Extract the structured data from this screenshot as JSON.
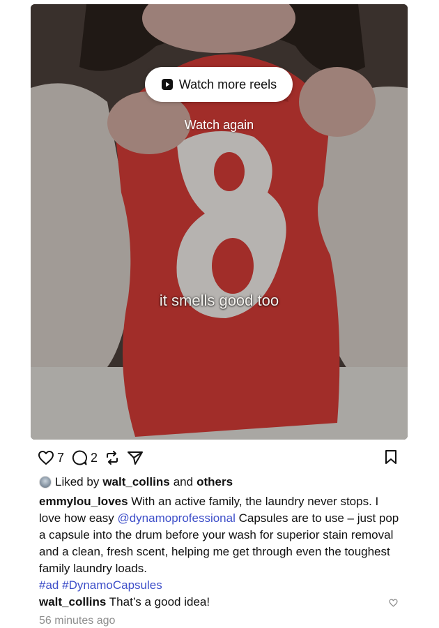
{
  "media": {
    "reels_button_label": "Watch more reels",
    "watch_again_label": "Watch again",
    "caption_overlay": "it smells good too",
    "jersey_number": "8"
  },
  "actions": {
    "likes_count": "7",
    "comments_count": "2"
  },
  "likes": {
    "prefix": "Liked by",
    "user": "walt_collins",
    "and": "and",
    "others": "others"
  },
  "post": {
    "author": "emmylou_loves",
    "text_1": "With an active family, the laundry never stops. I love how easy",
    "mention": "@dynamoprofessional",
    "text_2": "Capsules are to use – just pop a capsule into the drum before your wash for superior stain removal and a clean, fresh scent, helping me get through even the toughest family laundry loads.",
    "hashtag_1": "#ad",
    "hashtag_2": "#DynamoCapsules"
  },
  "comment": {
    "user": "walt_collins",
    "text": "That’s a good idea!"
  },
  "timestamp": "56 minutes ago",
  "colors": {
    "link": "#3e4fc9",
    "jersey": "#cf3a35",
    "muted": "#8e8e8e"
  }
}
